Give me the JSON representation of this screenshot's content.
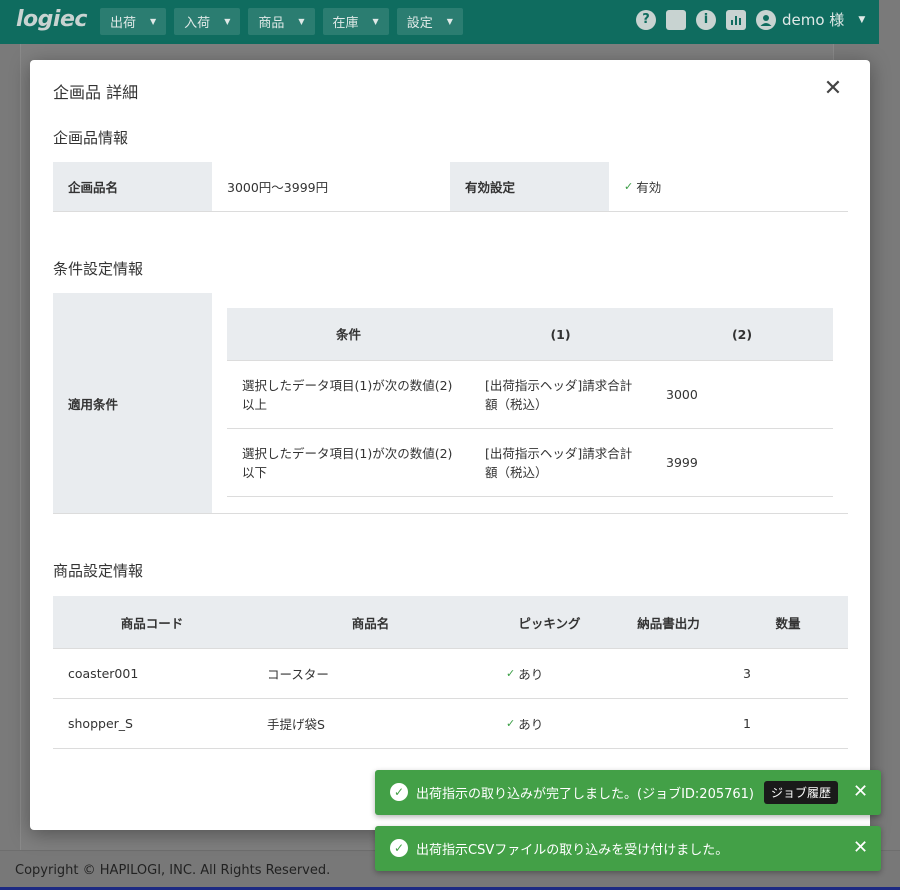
{
  "nav": {
    "logo": "logiec",
    "menus": [
      "出荷",
      "入荷",
      "商品",
      "在庫",
      "設定"
    ],
    "user": "demo 様"
  },
  "footer": {
    "copyright": "Copyright © HAPILOGI, INC. All Rights Reserved."
  },
  "modal": {
    "title": "企画品 詳細",
    "close": "✕",
    "plan_section": {
      "title": "企画品情報",
      "name_label": "企画品名",
      "name_value": "3000円〜3999円",
      "status_label": "有効設定",
      "status_value": "有効"
    },
    "condition_section": {
      "title": "条件設定情報",
      "row_label": "適用条件",
      "headers": [
        "条件",
        "(1)",
        "(2)"
      ],
      "rows": [
        {
          "condition": "選択したデータ項目(1)が次の数値(2)以上",
          "param1": "[出荷指示ヘッダ]請求合計額（税込）",
          "param2": "3000"
        },
        {
          "condition": "選択したデータ項目(1)が次の数値(2)以下",
          "param1": "[出荷指示ヘッダ]請求合計額（税込）",
          "param2": "3999"
        }
      ]
    },
    "product_section": {
      "title": "商品設定情報",
      "headers": [
        "商品コード",
        "商品名",
        "ピッキング",
        "納品書出力",
        "数量"
      ],
      "rows": [
        {
          "code": "coaster001",
          "name": "コースター",
          "picking": "あり",
          "delivery_note": "",
          "qty": "3"
        },
        {
          "code": "shopper_S",
          "name": "手提げ袋S",
          "picking": "あり",
          "delivery_note": "",
          "qty": "1"
        }
      ]
    }
  },
  "toasts": [
    {
      "message": "出荷指示の取り込みが完了しました。(ジョブID:205761)",
      "button": "ジョブ履歴"
    },
    {
      "message": "出荷指示CSVファイルの取り込みを受け付けました。"
    }
  ]
}
